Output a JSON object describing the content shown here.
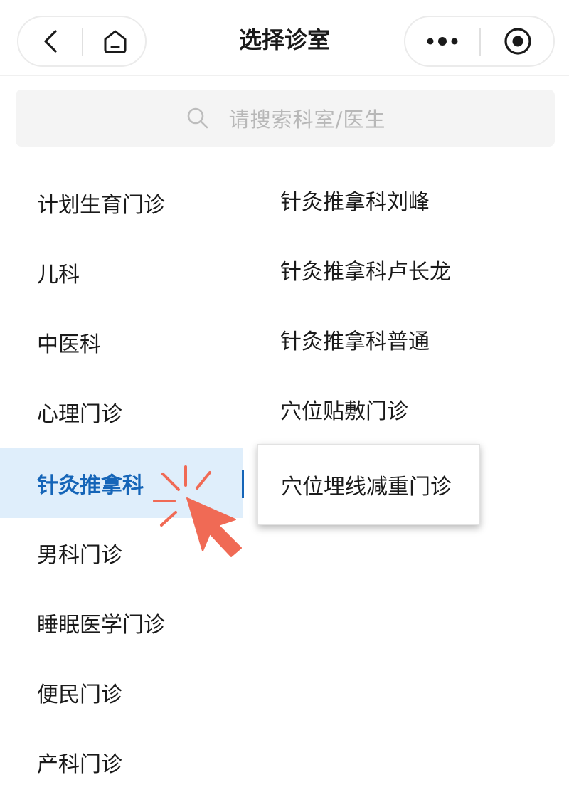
{
  "header": {
    "title": "选择诊室",
    "back_icon": "chevron-left-icon",
    "home_icon": "home-icon",
    "more_icon": "more-dots-icon",
    "target_icon": "target-icon"
  },
  "search": {
    "placeholder": "请搜索科室/医生",
    "icon": "search-icon"
  },
  "departments": [
    {
      "label": "计划生育门诊",
      "active": false
    },
    {
      "label": "儿科",
      "active": false
    },
    {
      "label": "中医科",
      "active": false
    },
    {
      "label": "心理门诊",
      "active": false
    },
    {
      "label": "针灸推拿科",
      "active": true
    },
    {
      "label": "男科门诊",
      "active": false
    },
    {
      "label": "睡眠医学门诊",
      "active": false
    },
    {
      "label": "便民门诊",
      "active": false
    },
    {
      "label": "产科门诊",
      "active": false
    }
  ],
  "sub_items": [
    {
      "label": "针灸推拿科刘峰"
    },
    {
      "label": "针灸推拿科卢长龙"
    },
    {
      "label": "针灸推拿科普通"
    },
    {
      "label": "穴位贴敷门诊"
    },
    {
      "label": "穴位埋线减重门诊",
      "highlighted": true
    }
  ],
  "colors": {
    "accent": "#1565b8",
    "active_bg": "#dfeefb",
    "pointer": "#f06a55"
  }
}
